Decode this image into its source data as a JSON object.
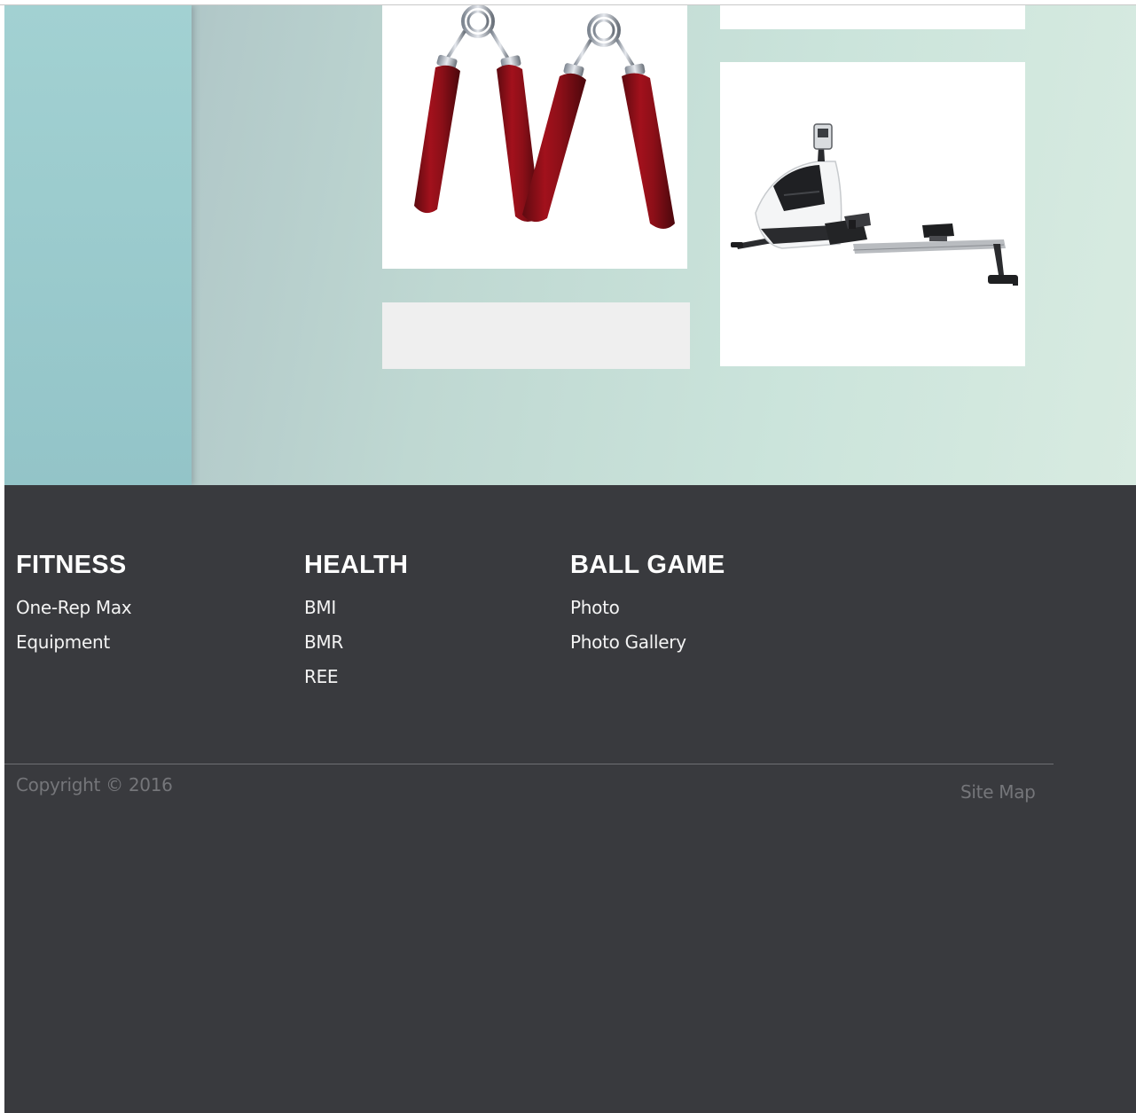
{
  "footer": {
    "columns": [
      {
        "heading": "FITNESS",
        "links": [
          "One-Rep Max",
          "Equipment"
        ]
      },
      {
        "heading": "HEALTH",
        "links": [
          "BMI",
          "BMR",
          "REE"
        ]
      },
      {
        "heading": "BALL GAME",
        "links": [
          "Photo",
          "Photo Gallery"
        ]
      }
    ],
    "copyright": "Copyright © 2016",
    "site_map": "Site Map"
  },
  "colors": {
    "footer_bg": "#393a3e",
    "heading": "#ffffff",
    "link": "#f3f3f3",
    "muted": "#75767a",
    "hero_left": "#93c4c8",
    "hero_right": "#d8ebe1"
  },
  "images": {
    "grippers": "hand-gripper-image",
    "rower": "rowing-machine-image"
  }
}
